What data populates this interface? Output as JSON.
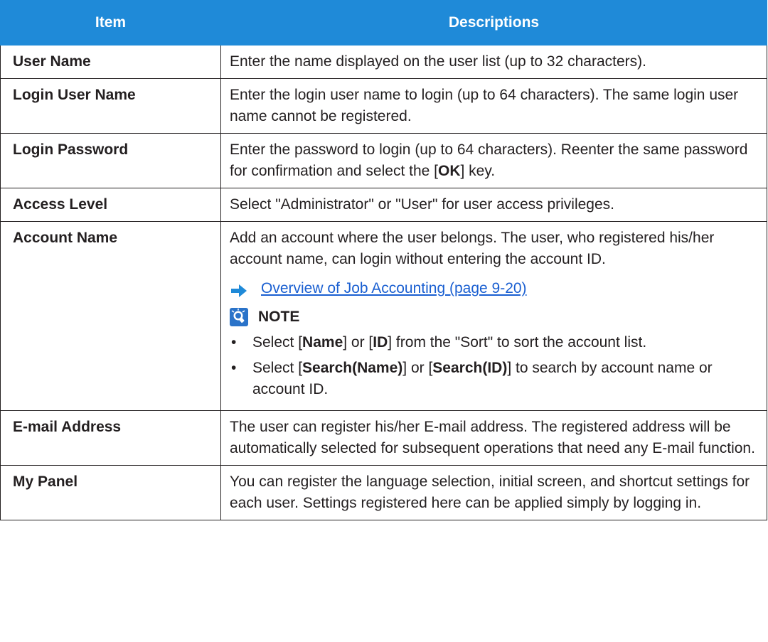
{
  "header": {
    "item": "Item",
    "descriptions": "Descriptions"
  },
  "rows": [
    {
      "item": "User Name",
      "desc": "Enter the name displayed on the user list (up to 32 characters)."
    },
    {
      "item": "Login User Name",
      "desc": "Enter the login user name to login (up to 64 characters). The same login user name cannot be registered."
    },
    {
      "item": "Login Password",
      "desc_a": "Enter the password to login (up to 64 characters). Reenter the same password for confirmation and select the [",
      "desc_key": "OK",
      "desc_b": "] key."
    },
    {
      "item": "Access Level",
      "desc": "Select \"Administrator\" or \"User\" for user access privileges."
    },
    {
      "item": "Account Name",
      "desc": "Add an account where the user belongs. The user, who registered his/her account name, can login without entering the account ID.",
      "link": "Overview of Job Accounting (page 9-20)",
      "note_label": "NOTE",
      "notes": [
        {
          "a": "Select [",
          "k1": "Name",
          "b": "] or [",
          "k2": "ID",
          "c": "] from the \"Sort\" to sort the account list."
        },
        {
          "a": "Select [",
          "k1": "Search(Name)",
          "b": "] or [",
          "k2": "Search(ID)",
          "c": "] to search by account name or account ID."
        }
      ]
    },
    {
      "item": "E-mail Address",
      "desc": "The user can register his/her E-mail address. The registered address will be automatically selected for subsequent operations that need any E-mail function."
    },
    {
      "item": "My Panel",
      "desc": "You can register the language selection, initial screen, and shortcut settings for each user. Settings registered here can be applied simply by logging in."
    }
  ],
  "colors": {
    "header_bg": "#1f8ad8",
    "link": "#1a5fd1",
    "arrow": "#1f8ad8"
  },
  "icons": {
    "link_arrow": "arrow-right-icon",
    "note": "lightbulb-note-icon"
  }
}
